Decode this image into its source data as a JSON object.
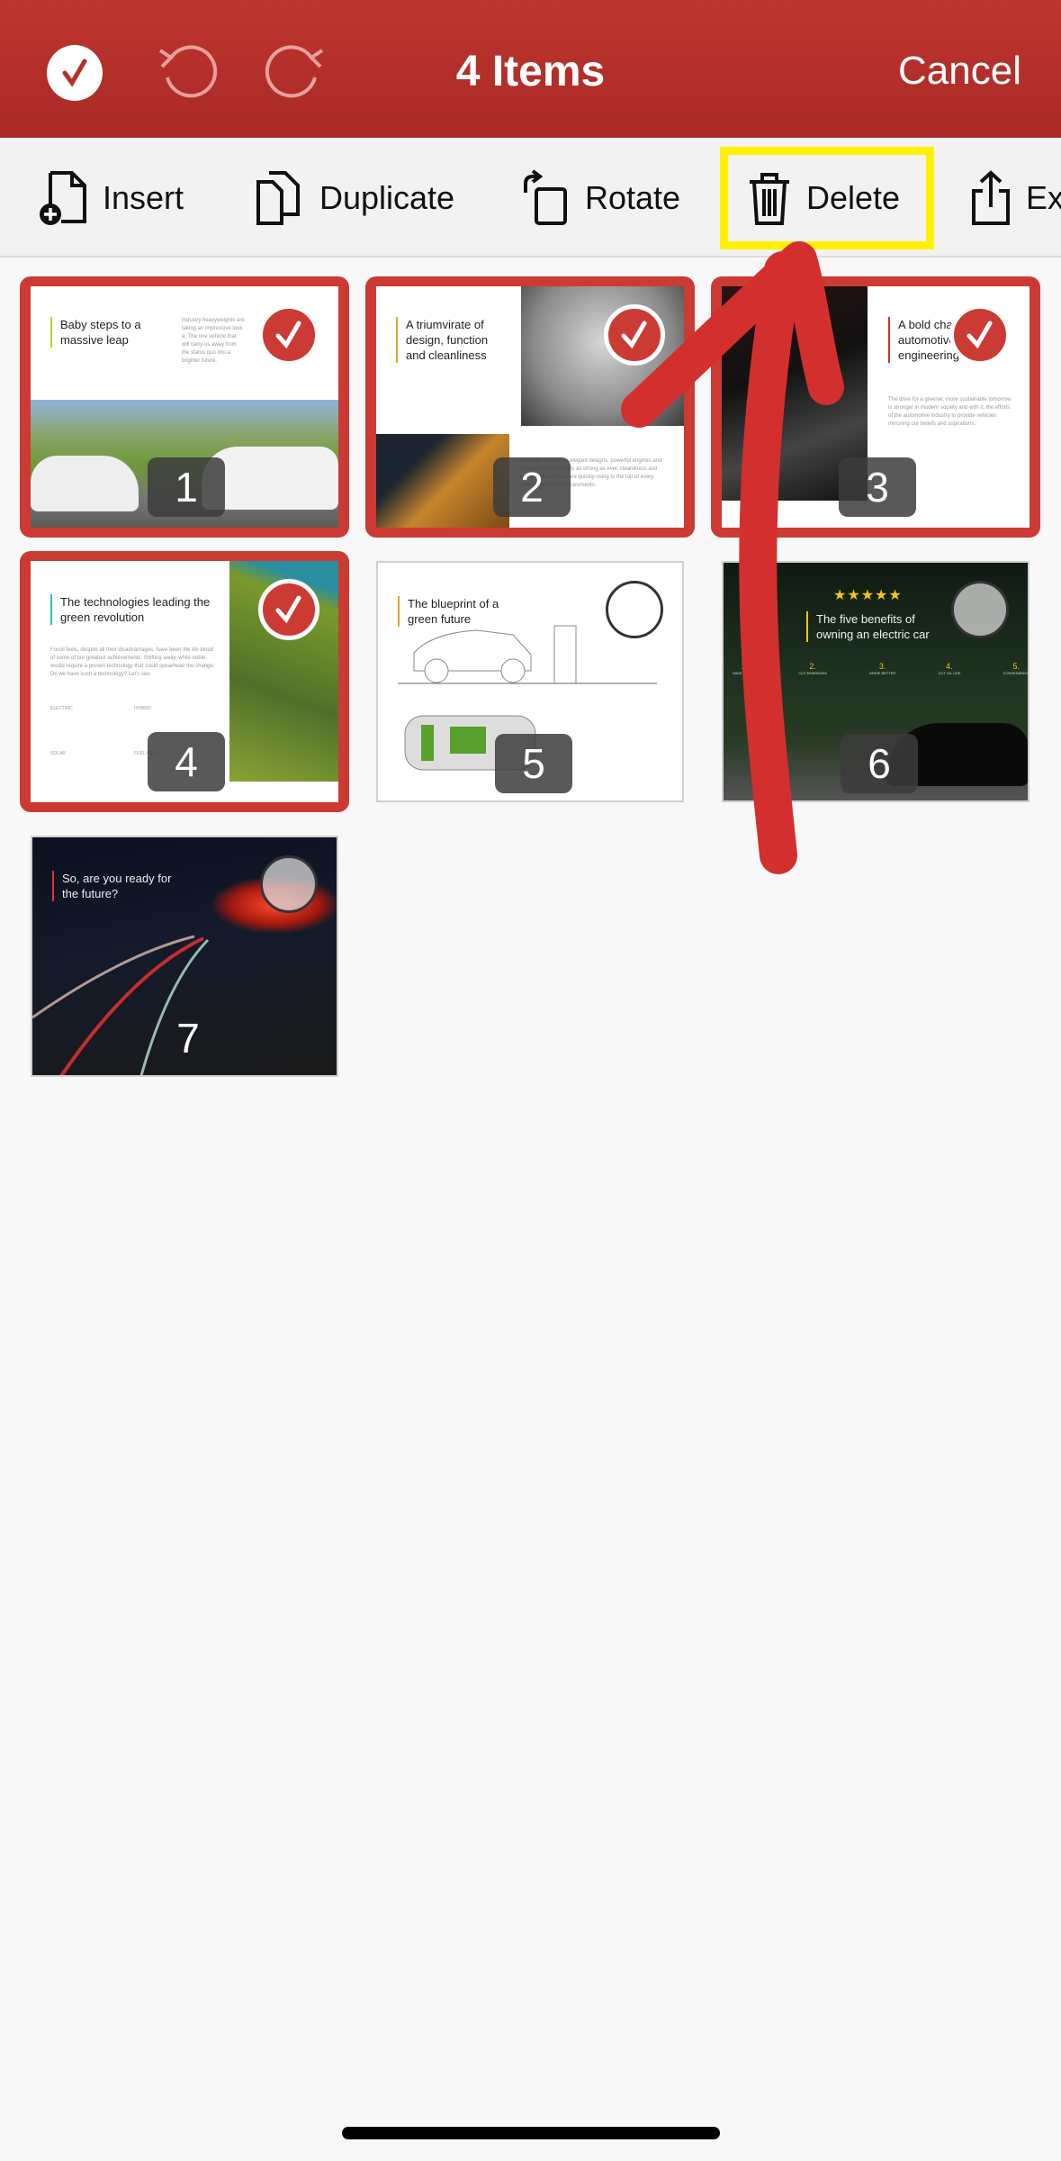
{
  "header": {
    "title": "4 Items",
    "cancel_label": "Cancel",
    "icons": [
      "select-all-check-icon",
      "undo-icon",
      "redo-icon"
    ]
  },
  "toolbar": {
    "items": [
      {
        "label": "Insert",
        "icon": "insert-page-icon"
      },
      {
        "label": "Duplicate",
        "icon": "duplicate-icon"
      },
      {
        "label": "Rotate",
        "icon": "rotate-icon"
      },
      {
        "label": "Delete",
        "icon": "trash-icon",
        "highlighted": true
      },
      {
        "label": "Ex",
        "icon": "export-icon"
      }
    ]
  },
  "annotation": {
    "highlight_color": "#fff200",
    "arrow_color": "#d32f2f"
  },
  "colors": {
    "accent": "#cc3a34"
  },
  "slides": [
    {
      "number": "1",
      "selected": true,
      "title": "Baby steps to a massive leap",
      "body": "Industry heavyweights are taking an impressive look a. The one vehicle that will carry us away from the status quo into a brighter future."
    },
    {
      "number": "2",
      "selected": true,
      "title": "A triumvirate of design, function and cleanliness",
      "body": "While the search for elegant designs, powerful engines and comfortable interiors is as strong as ever, cleanliness and straightforwardness are quickly rising to the top of every consumer's list of requirements."
    },
    {
      "number": "3",
      "selected": true,
      "title": "A bold chapter in automotive engineering",
      "body": "The drive for a greener, more sustainable tomorrow is stronger in modern society and with it, the efforts of the automotive industry to provide vehicles mirroring our beliefs and aspirations."
    },
    {
      "number": "4",
      "selected": true,
      "title": "The technologies leading the green revolution",
      "body": "Fossil fuels, despite all their disadvantages, have been the life blood of some of our greatest achievements. Shifting away, while noble, would require a proven technology that could spearhead the change. Do we have such a technology? Let's see.",
      "features": [
        "ELECTRIC",
        "HYBRID",
        "SOLAR",
        "FUEL CELL"
      ]
    },
    {
      "number": "5",
      "selected": false,
      "title": "The blueprint of a green future"
    },
    {
      "number": "6",
      "selected": false,
      "title": "The five benefits of owning an electric car",
      "benefits": [
        {
          "n": "1.",
          "label": "SAVE MONEY"
        },
        {
          "n": "2.",
          "label": "CUT EMISSIONS"
        },
        {
          "n": "3.",
          "label": "DRIVE BETTER"
        },
        {
          "n": "4.",
          "label": "CUT OIL USE"
        },
        {
          "n": "5.",
          "label": "CONVENIENCE"
        }
      ],
      "rating_stars": 5
    },
    {
      "number": "7",
      "selected": false,
      "title": "So, are you ready for the future?"
    }
  ]
}
